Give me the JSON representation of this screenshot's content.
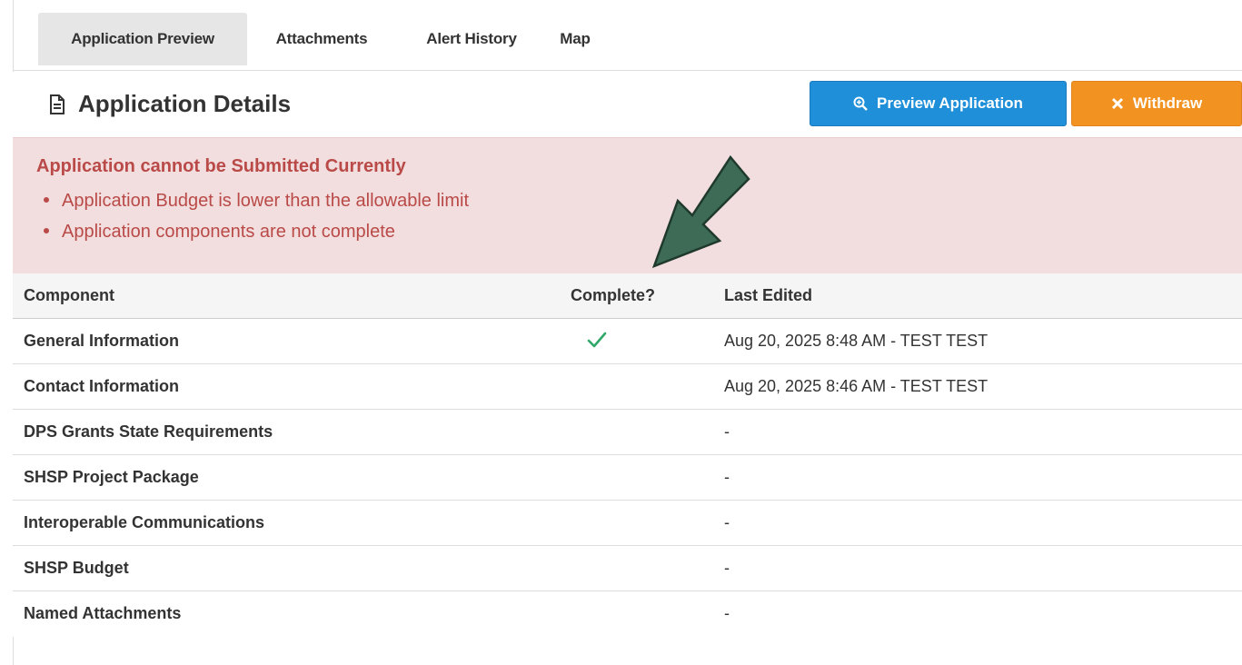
{
  "tabs": [
    {
      "label": "Application Preview",
      "active": true
    },
    {
      "label": "Attachments",
      "active": false
    },
    {
      "label": "Alert History",
      "active": false
    },
    {
      "label": "Map",
      "active": false
    }
  ],
  "header": {
    "title": "Application Details",
    "title_icon": "document-icon",
    "preview_label": "Preview Application",
    "preview_icon": "zoom-in-icon",
    "withdraw_label": "Withdraw",
    "withdraw_icon": "close-icon"
  },
  "alert": {
    "title": "Application cannot be Submitted Currently",
    "items": [
      "Application Budget is lower than the allowable limit",
      "Application components are not complete"
    ]
  },
  "table": {
    "headers": {
      "component": "Component",
      "complete": "Complete?",
      "last_edited": "Last Edited"
    },
    "rows": [
      {
        "component": "General Information",
        "complete": true,
        "last_edited": "Aug 20, 2025 8:48 AM - TEST TEST"
      },
      {
        "component": "Contact Information",
        "complete": false,
        "last_edited": "Aug 20, 2025 8:46 AM - TEST TEST"
      },
      {
        "component": "DPS Grants State Requirements",
        "complete": false,
        "last_edited": "-"
      },
      {
        "component": "SHSP Project Package",
        "complete": false,
        "last_edited": "-"
      },
      {
        "component": "Interoperable Communications",
        "complete": false,
        "last_edited": "-"
      },
      {
        "component": "SHSP Budget",
        "complete": false,
        "last_edited": "-"
      },
      {
        "component": "Named Attachments",
        "complete": false,
        "last_edited": "-"
      }
    ]
  },
  "colors": {
    "preview_button": "#1e8fd8",
    "withdraw_button": "#f29321",
    "alert_background": "#f2dede",
    "alert_text": "#b94a48",
    "check": "#2fa86a",
    "annotation_arrow": "#3d6b55"
  }
}
